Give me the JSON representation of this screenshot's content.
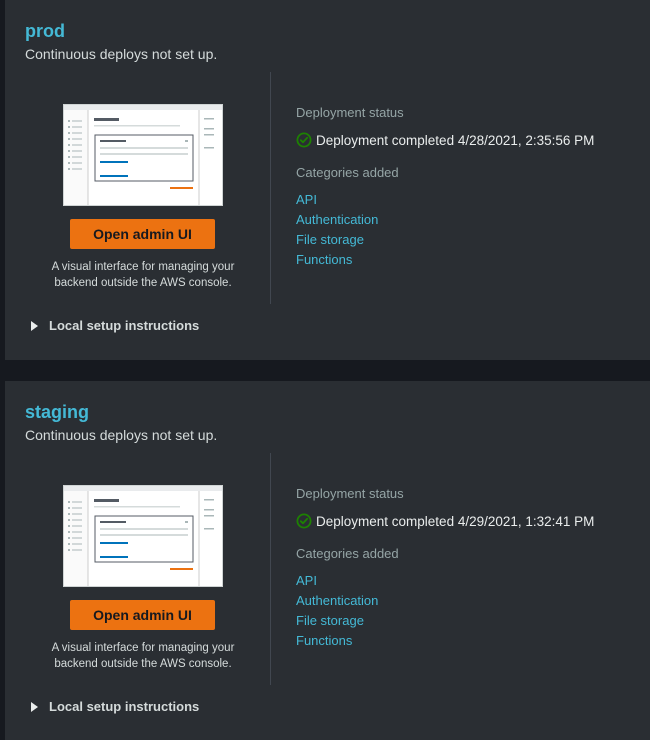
{
  "environments": [
    {
      "name": "prod",
      "subtitle": "Continuous deploys not set up.",
      "admin_button": "Open admin UI",
      "admin_desc_1": "A visual interface for managing your",
      "admin_desc_2": "backend outside the AWS console.",
      "local_setup": "Local setup instructions",
      "status_label": "Deployment status",
      "status_text": "Deployment completed 4/28/2021, 2:35:56 PM",
      "categories_label": "Categories added",
      "categories": [
        "API",
        "Authentication",
        "File storage",
        "Functions"
      ]
    },
    {
      "name": "staging",
      "subtitle": "Continuous deploys not set up.",
      "admin_button": "Open admin UI",
      "admin_desc_1": "A visual interface for managing your",
      "admin_desc_2": "backend outside the AWS console.",
      "local_setup": "Local setup instructions",
      "status_label": "Deployment status",
      "status_text": "Deployment completed 4/29/2021, 1:32:41 PM",
      "categories_label": "Categories added",
      "categories": [
        "API",
        "Authentication",
        "File storage",
        "Functions"
      ]
    }
  ],
  "colors": {
    "accent_link": "#44b9d6",
    "button_orange": "#ec7211",
    "success_green": "#1d8102",
    "card_bg": "#2a2e33"
  },
  "icons": {
    "status": "check-circle-icon",
    "expand": "caret-right-icon"
  }
}
